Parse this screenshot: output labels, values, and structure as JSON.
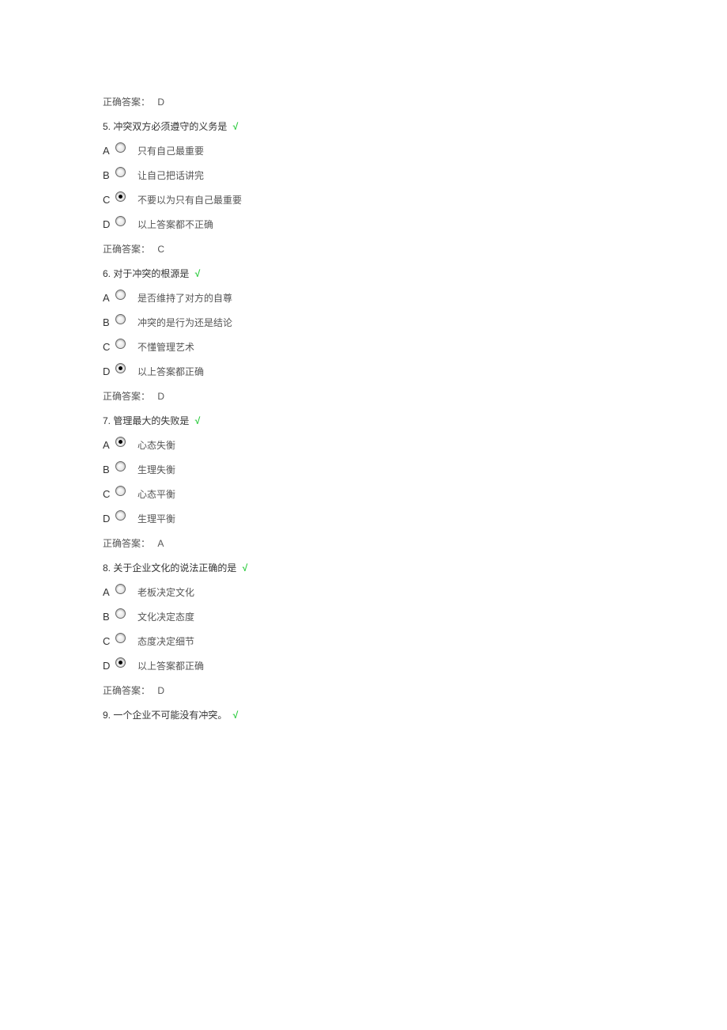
{
  "answer_prefix_4": "正确答案：",
  "answer_value_4": "D",
  "q5": {
    "num": "5.",
    "text": "冲突双方必须遵守的义务是",
    "check": "√",
    "options": [
      {
        "letter": "A",
        "text": "只有自己最重要",
        "selected": false
      },
      {
        "letter": "B",
        "text": "让自己把话讲完",
        "selected": false
      },
      {
        "letter": "C",
        "text": "不要以为只有自己最重要",
        "selected": true
      },
      {
        "letter": "D",
        "text": "以上答案都不正确",
        "selected": false
      }
    ],
    "answer_prefix": "正确答案：",
    "answer_value": "C"
  },
  "q6": {
    "num": "6.",
    "text": "对于冲突的根源是",
    "check": "√",
    "options": [
      {
        "letter": "A",
        "text": "是否维持了对方的自尊",
        "selected": false
      },
      {
        "letter": "B",
        "text": "冲突的是行为还是结论",
        "selected": false
      },
      {
        "letter": "C",
        "text": "不懂管理艺术",
        "selected": false
      },
      {
        "letter": "D",
        "text": "以上答案都正确",
        "selected": true
      }
    ],
    "answer_prefix": "正确答案：",
    "answer_value": "D"
  },
  "q7": {
    "num": "7.",
    "text": "管理最大的失败是",
    "check": "√",
    "options": [
      {
        "letter": "A",
        "text": "心态失衡",
        "selected": true
      },
      {
        "letter": "B",
        "text": "生理失衡",
        "selected": false
      },
      {
        "letter": "C",
        "text": "心态平衡",
        "selected": false
      },
      {
        "letter": "D",
        "text": "生理平衡",
        "selected": false
      }
    ],
    "answer_prefix": "正确答案：",
    "answer_value": "A"
  },
  "q8": {
    "num": "8.",
    "text": "关于企业文化的说法正确的是",
    "check": "√",
    "options": [
      {
        "letter": "A",
        "text": "老板决定文化",
        "selected": false
      },
      {
        "letter": "B",
        "text": "文化决定态度",
        "selected": false
      },
      {
        "letter": "C",
        "text": "态度决定细节",
        "selected": false
      },
      {
        "letter": "D",
        "text": "以上答案都正确",
        "selected": true
      }
    ],
    "answer_prefix": "正确答案：",
    "answer_value": "D"
  },
  "q9": {
    "num": "9.",
    "text": "一个企业不可能没有冲突。",
    "check": "√"
  }
}
